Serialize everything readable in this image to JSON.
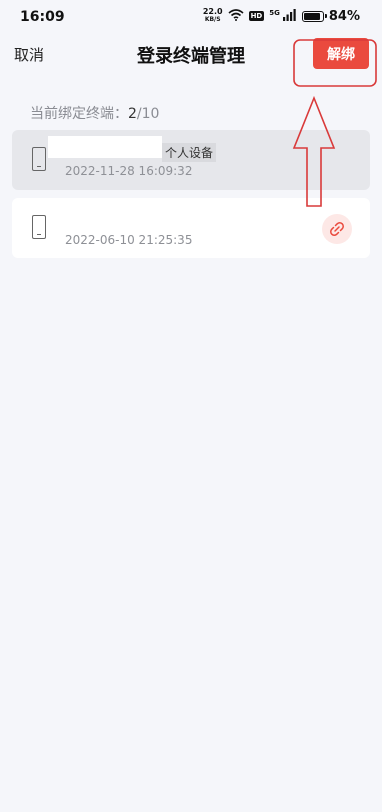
{
  "status_bar": {
    "time": "16:09",
    "speed_value": "22.0",
    "speed_unit": "KB/S",
    "hd": "HD",
    "network": "5G",
    "battery": "84%"
  },
  "nav": {
    "cancel_label": "取消",
    "title": "登录终端管理",
    "unbind_label": "解绑"
  },
  "bound_count": {
    "label": "当前绑定终端：",
    "current": "2",
    "total": "/10"
  },
  "devices": [
    {
      "name": "",
      "tag": "个人设备",
      "date": "2022-11-28 16:09:32"
    },
    {
      "name": "",
      "date": "2022-06-10 21:25:35"
    }
  ],
  "colors": {
    "accent": "#ea4a3e",
    "annotation": "#d93a3a",
    "background": "#f5f6fa"
  }
}
